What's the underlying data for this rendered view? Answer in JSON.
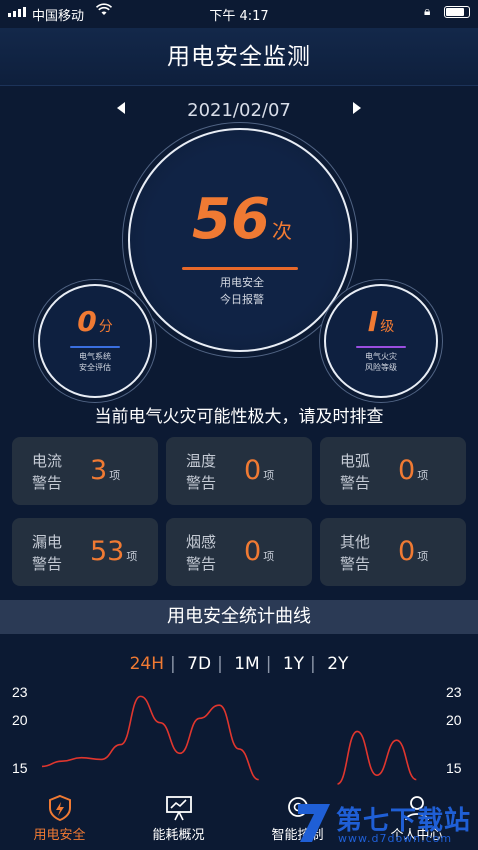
{
  "status_bar": {
    "carrier": "中国移动",
    "time": "下午 4:17"
  },
  "header": {
    "title": "用电安全监测"
  },
  "date_nav": {
    "date": "2021/02/07",
    "prev_icon": "triangle-left-icon",
    "next_icon": "triangle-right-icon"
  },
  "main_gauge": {
    "value": "56",
    "unit": "次",
    "label1": "用电安全",
    "label2": "今日报警"
  },
  "score_gauge": {
    "value": "0",
    "unit": "分",
    "label1": "电气系统",
    "label2": "安全评估",
    "bar_color": "#3a6fe0"
  },
  "level_gauge": {
    "value": "I",
    "unit": "级",
    "label1": "电气火灾",
    "label2": "风险等级",
    "bar_color": "#9a4ee0"
  },
  "warning_message": "当前电气火灾可能性极大，请及时排查",
  "alarm_cards": [
    {
      "name": "电流警告",
      "value": "3",
      "unit": "项"
    },
    {
      "name": "温度警告",
      "value": "0",
      "unit": "项"
    },
    {
      "name": "电弧警告",
      "value": "0",
      "unit": "项"
    },
    {
      "name": "漏电警告",
      "value": "53",
      "unit": "项"
    },
    {
      "name": "烟感警告",
      "value": "0",
      "unit": "项"
    },
    {
      "name": "其他警告",
      "value": "0",
      "unit": "项"
    }
  ],
  "stats_section": {
    "title": "用电安全统计曲线",
    "ranges": [
      "24H",
      "7D",
      "1M",
      "1Y",
      "2Y"
    ],
    "active_range": "24H"
  },
  "chart_data": {
    "type": "line",
    "y_ticks": [
      "23",
      "20",
      "15"
    ],
    "ylim": [
      13,
      23.5
    ],
    "series": [
      {
        "x": [
          0,
          1,
          2,
          3,
          4,
          5,
          6,
          7,
          8,
          9,
          10,
          11,
          12,
          13,
          14,
          15,
          16,
          17,
          18,
          19,
          20
        ],
        "values": [
          15,
          15.6,
          16,
          15.8,
          17.5,
          23,
          20,
          16.5,
          20.5,
          22,
          17,
          13.5,
          null,
          null,
          null,
          null,
          null,
          null,
          null,
          null,
          null
        ]
      },
      {
        "x": [
          0,
          1,
          2,
          3,
          4,
          5,
          6,
          7,
          8,
          9,
          10,
          11,
          12,
          13,
          14,
          15,
          16,
          17,
          18,
          19,
          20
        ],
        "values": [
          null,
          null,
          null,
          null,
          null,
          null,
          null,
          null,
          null,
          null,
          null,
          null,
          null,
          null,
          null,
          13,
          19,
          14,
          18,
          13.5,
          null
        ]
      }
    ],
    "line_color": "#e0362e"
  },
  "tabbar": {
    "items": [
      {
        "label": "用电安全",
        "icon": "shield-bolt-icon",
        "active": true
      },
      {
        "label": "能耗概况",
        "icon": "presentation-chart-icon",
        "active": false
      },
      {
        "label": "智能控制",
        "icon": "control-icon",
        "active": false
      },
      {
        "label": "个人中心",
        "icon": "user-icon",
        "active": false
      }
    ]
  },
  "watermark": {
    "title": "第七下载站",
    "url": "www.d7down.com"
  }
}
